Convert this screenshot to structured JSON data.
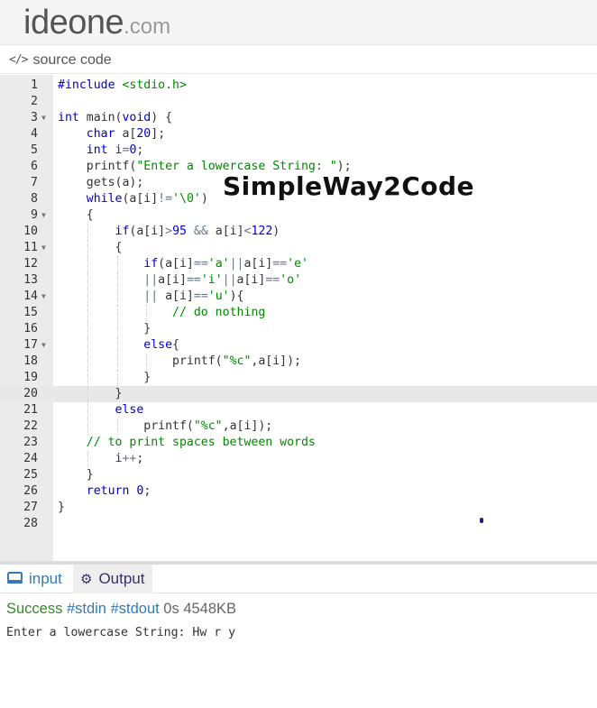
{
  "header": {
    "logo_main": "ideone",
    "logo_tld": ".com"
  },
  "source_bar": {
    "icon": "code-brackets-icon",
    "label": "source code"
  },
  "watermark": "SimpleWay2Code",
  "editor": {
    "active_line": 20,
    "lines": [
      {
        "n": "1",
        "fold": false,
        "text": "#include <stdio.h>"
      },
      {
        "n": "2",
        "fold": false,
        "text": ""
      },
      {
        "n": "3",
        "fold": true,
        "text": "int main(void) {"
      },
      {
        "n": "4",
        "fold": false,
        "text": "    char a[20];"
      },
      {
        "n": "5",
        "fold": false,
        "text": "    int i=0;"
      },
      {
        "n": "6",
        "fold": false,
        "text": "    printf(\"Enter a lowercase String: \");"
      },
      {
        "n": "7",
        "fold": false,
        "text": "    gets(a);"
      },
      {
        "n": "8",
        "fold": false,
        "text": "    while(a[i]!='\\0')"
      },
      {
        "n": "9",
        "fold": true,
        "text": "    {"
      },
      {
        "n": "10",
        "fold": false,
        "text": "        if(a[i]>95 && a[i]<122)"
      },
      {
        "n": "11",
        "fold": true,
        "text": "        {"
      },
      {
        "n": "12",
        "fold": false,
        "text": "            if(a[i]=='a'||a[i]=='e'"
      },
      {
        "n": "13",
        "fold": false,
        "text": "            ||a[i]=='i'||a[i]=='o'"
      },
      {
        "n": "14",
        "fold": true,
        "text": "            || a[i]=='u'){"
      },
      {
        "n": "15",
        "fold": false,
        "text": "                // do nothing"
      },
      {
        "n": "16",
        "fold": false,
        "text": "            }"
      },
      {
        "n": "17",
        "fold": true,
        "text": "            else{"
      },
      {
        "n": "18",
        "fold": false,
        "text": "                printf(\"%c\",a[i]);"
      },
      {
        "n": "19",
        "fold": false,
        "text": "            }"
      },
      {
        "n": "20",
        "fold": false,
        "text": "        }"
      },
      {
        "n": "21",
        "fold": false,
        "text": "        else"
      },
      {
        "n": "22",
        "fold": false,
        "text": "            printf(\"%c\",a[i]);"
      },
      {
        "n": "23",
        "fold": false,
        "text": "    // to print spaces between words"
      },
      {
        "n": "24",
        "fold": false,
        "text": "        i++;"
      },
      {
        "n": "25",
        "fold": false,
        "text": "    }"
      },
      {
        "n": "26",
        "fold": false,
        "text": "    return 0;"
      },
      {
        "n": "27",
        "fold": false,
        "text": "}"
      },
      {
        "n": "28",
        "fold": false,
        "text": ""
      }
    ]
  },
  "tabs": {
    "input": {
      "icon": "keyboard-icon",
      "label": "input"
    },
    "output": {
      "icon": "gears-icon",
      "label": "Output"
    }
  },
  "status": {
    "result": "Success",
    "stdin_link": "#stdin",
    "stdout_link": "#stdout",
    "time": "0s",
    "memory": "4548KB"
  },
  "stdout": "Enter a lowercase String: Hw r y",
  "colors": {
    "success": "#2e8b23",
    "link": "#337ab7",
    "keyword": "#0000cc",
    "string": "#008800"
  }
}
